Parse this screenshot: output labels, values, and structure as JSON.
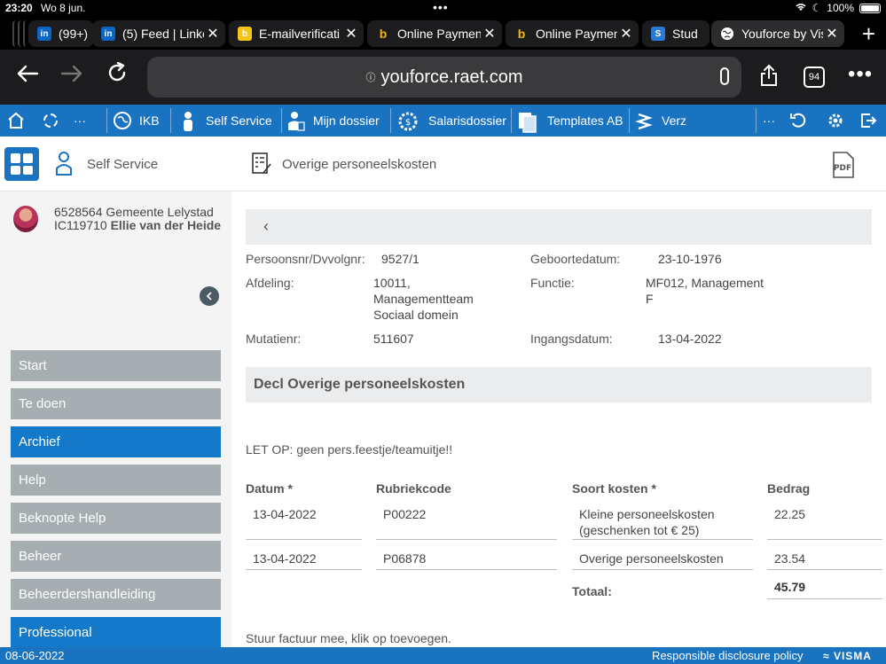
{
  "status_bar": {
    "time": "23:20",
    "date": "Wo 8 jun.",
    "battery": "100%"
  },
  "browser": {
    "tabs": [
      {
        "label": "(99+)",
        "icon": "linkedin-icon",
        "icon_text": "in"
      },
      {
        "label": "(5) Feed | Linke",
        "icon": "linkedin-icon",
        "icon_text": "in"
      },
      {
        "label": "E-mailverificati",
        "icon": "bookmark-icon",
        "icon_text": "b"
      },
      {
        "label": "Online Paymen",
        "icon": "b-icon",
        "icon_text": "b"
      },
      {
        "label": "Online Paymen",
        "icon": "b-icon",
        "icon_text": "b"
      },
      {
        "label": "Stud",
        "icon": "s-icon",
        "icon_text": "S"
      },
      {
        "label": "Youforce by Vis",
        "icon": "globe-icon",
        "icon_text": ""
      }
    ],
    "url": "youforce.raet.com",
    "tab_count": "94"
  },
  "toolbar": {
    "items": [
      {
        "label": "IKB"
      },
      {
        "label": "Self Service"
      },
      {
        "label": "Mijn dossier"
      },
      {
        "label": "Salarisdossier"
      },
      {
        "label": "Templates AB"
      },
      {
        "label": "Verz"
      }
    ],
    "more": "···"
  },
  "header": {
    "section": "Self Service",
    "page_title": "Overige personeelskosten"
  },
  "user": {
    "line1": "6528564 Gemeente Lelystad",
    "line2_prefix": "IC119710 ",
    "name": "Ellie van der Heide"
  },
  "menu": [
    {
      "label": "Start",
      "active": false
    },
    {
      "label": "Te doen",
      "active": false
    },
    {
      "label": "Archief",
      "active": true
    },
    {
      "label": "Help",
      "active": false
    },
    {
      "label": "Beknopte Help",
      "active": false
    },
    {
      "label": "Beheer",
      "active": false
    },
    {
      "label": "Beheerdershandleiding",
      "active": false
    },
    {
      "label": "Professional",
      "active": true
    }
  ],
  "details": {
    "persoonsnr_label": "Persoonsnr/Dvvolgnr:",
    "persoonsnr": "9527/1",
    "geboortedatum_label": "Geboortedatum:",
    "geboortedatum": "23-10-1976",
    "afdeling_label": "Afdeling:",
    "afdeling_line1": "10011,",
    "afdeling_line2": "Managementteam",
    "afdeling_line3": "Sociaal domein",
    "functie_label": "Functie:",
    "functie_line1": "MF012, Management",
    "functie_line2": "F",
    "mutatienr_label": "Mutatienr:",
    "mutatienr": "511607",
    "ingangsdatum_label": "Ingangsdatum:",
    "ingangsdatum": "13-04-2022"
  },
  "section_title": "Decl Overige personeelskosten",
  "notice": "LET OP: geen pers.feestje/teamuitje!!",
  "table": {
    "headers": {
      "datum": "Datum *",
      "rubriek": "Rubriekcode",
      "soort": "Soort kosten *",
      "bedrag": "Bedrag"
    },
    "rows": [
      {
        "datum": "13-04-2022",
        "rubriek": "P00222",
        "soort_line1": "Kleine personeelskosten",
        "soort_line2": "(geschenken tot € 25)",
        "bedrag": "22.25"
      },
      {
        "datum": "13-04-2022",
        "rubriek": "P06878",
        "soort_line1": "Overige personeelskosten",
        "soort_line2": "",
        "bedrag": "23.54"
      }
    ],
    "total_label": "Totaal:",
    "total": "45.79"
  },
  "footnote": "Stuur factuur mee, klik op toevoegen.",
  "footer": {
    "date": "08-06-2022",
    "disclosure": "Responsible disclosure policy",
    "brand": "VISMA"
  }
}
